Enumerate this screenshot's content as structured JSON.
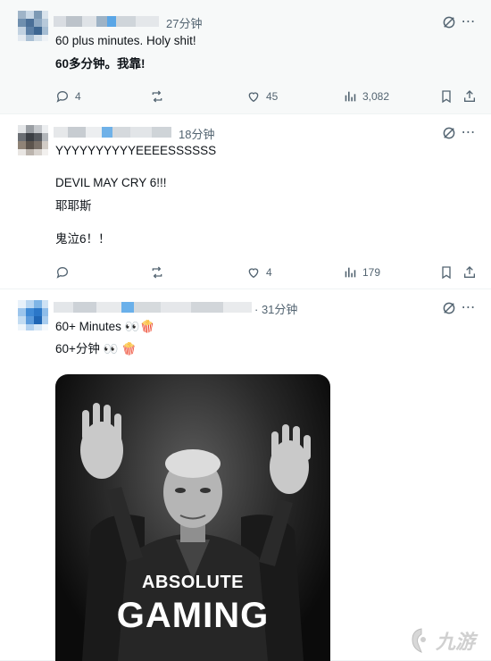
{
  "posts": [
    {
      "time": "27分钟",
      "lines": [
        "60 plus minutes. Holy shit!",
        "60多分钟。我靠!"
      ],
      "replies": "4",
      "reposts": "",
      "likes": "45",
      "views": "3,082"
    },
    {
      "time": "18分钟",
      "lines": [
        "YYYYYYYYYYEEEESSSSSS",
        "DEVIL MAY CRY 6!!!",
        "耶耶斯",
        "鬼泣6！！"
      ],
      "replies": "",
      "reposts": "",
      "likes": "4",
      "views": "179"
    },
    {
      "time": "· 31分钟",
      "lines": [
        "60+ Minutes 👀🍿",
        "60+分钟 👀 🍿"
      ],
      "media": {
        "overlay_line1": "ABSOLUTE",
        "overlay_line2": "GAMING"
      }
    }
  ],
  "watermark": "九游",
  "colors": {
    "text": "#0f1419",
    "muted": "#536471",
    "highlight_bg": "#f7f9f9",
    "divider": "#eff3f4"
  },
  "icons": {
    "header": [
      "grok-icon",
      "more-icon"
    ],
    "actions": [
      "reply-icon",
      "repost-icon",
      "like-icon",
      "views-icon",
      "bookmark-icon",
      "share-icon"
    ]
  }
}
